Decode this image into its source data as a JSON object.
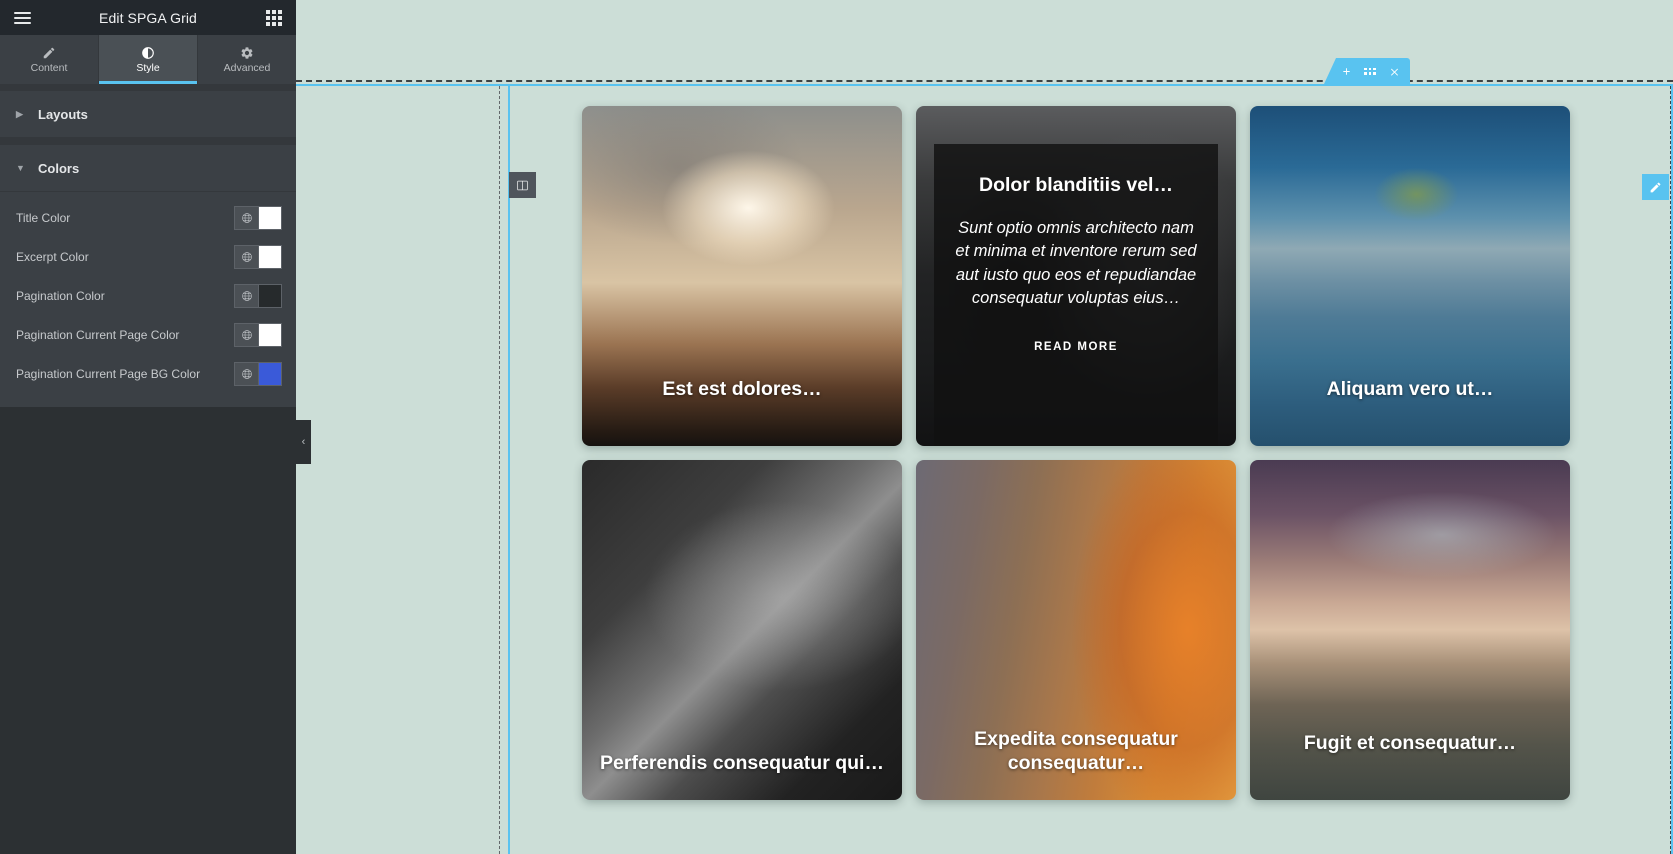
{
  "sidebar": {
    "header": {
      "title": "Edit SPGA Grid",
      "menu_icon": "hamburger-icon",
      "apps_icon": "apps-grid-icon"
    },
    "tabs": [
      {
        "label": "Content",
        "icon": "pencil-icon",
        "active": false
      },
      {
        "label": "Style",
        "icon": "contrast-icon",
        "active": true
      },
      {
        "label": "Advanced",
        "icon": "gear-icon",
        "active": false
      }
    ],
    "sections": [
      {
        "label": "Layouts",
        "expanded": false,
        "caret": "▶"
      },
      {
        "label": "Colors",
        "expanded": true,
        "caret": "▼"
      }
    ],
    "color_controls": [
      {
        "label": "Title Color",
        "value": "#ffffff",
        "globe_icon": "globe-icon"
      },
      {
        "label": "Excerpt Color",
        "value": "#ffffff",
        "globe_icon": "globe-icon"
      },
      {
        "label": "Pagination Color",
        "value": "#262a2c",
        "globe_icon": "globe-icon"
      },
      {
        "label": "Pagination Current Page Color",
        "value": "#ffffff",
        "globe_icon": "globe-icon"
      },
      {
        "label": "Pagination Current Page BG Color",
        "value": "#3a5ad9",
        "globe_icon": "globe-icon"
      }
    ],
    "collapse_handle": {
      "icon": "chevron-left-icon",
      "glyph": "‹"
    }
  },
  "canvas": {
    "background_color": "#ccded7",
    "accent_color": "#59c3f0",
    "section_toolbar": {
      "add_label": "+",
      "drag_icon": "drag-dots-icon",
      "close_label": "✕"
    },
    "column_handle": {
      "icon": "columns-icon"
    },
    "edit_handle": {
      "icon": "pencil-edit-icon"
    }
  },
  "grid": {
    "cards": [
      {
        "title": "Est est dolores…",
        "photo": "ph-clouds",
        "photo_name": "sunbeam-clouds-landscape-photo",
        "hovered": false,
        "two_line": false
      },
      {
        "title": "Dolor blanditiis vel…",
        "photo": "ph-diver",
        "photo_name": "underwater-diver-photo",
        "hovered": true,
        "two_line": false,
        "excerpt": "Sunt optio omnis architecto nam et minima et inventore rerum sed aut iusto quo eos et repudiandae consequatur voluptas eius…",
        "read_more": "READ MORE"
      },
      {
        "title": "Aliquam vero ut…",
        "photo": "ph-lake",
        "photo_name": "lone-tree-lake-photo",
        "hovered": false,
        "two_line": false
      },
      {
        "title": "Perferendis consequatur qui…",
        "photo": "ph-arch",
        "photo_name": "monochrome-arch-architecture-photo",
        "hovered": false,
        "two_line": true
      },
      {
        "title": "Expedita consequatur consequatur…",
        "photo": "ph-mars",
        "photo_name": "mars-canyon-aerial-photo",
        "hovered": false,
        "two_line": true
      },
      {
        "title": "Fugit et consequatur…",
        "photo": "ph-sunset",
        "photo_name": "rocky-coast-sunset-photo",
        "hovered": false,
        "two_line": false
      }
    ]
  }
}
